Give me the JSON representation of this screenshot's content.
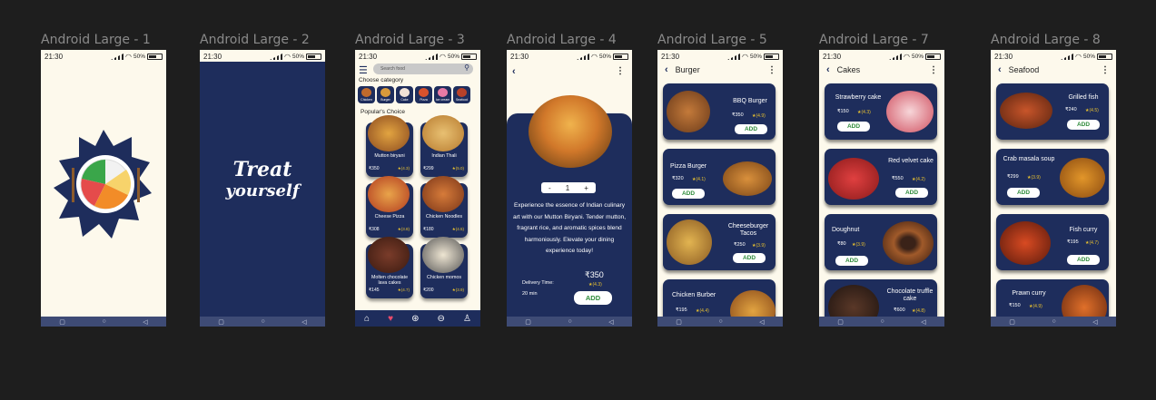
{
  "frames": [
    {
      "label": "Android Large - 1"
    },
    {
      "label": "Android Large - 2"
    },
    {
      "label": "Android Large - 3"
    },
    {
      "label": "Android Large - 4"
    },
    {
      "label": "Android Large - 5"
    },
    {
      "label": "Android Large - 7"
    },
    {
      "label": "Android Large - 8"
    }
  ],
  "status": {
    "time": "21:30",
    "battery": "50%"
  },
  "splash": {
    "logo_text_1": "Treat",
    "logo_text_2": "yourself"
  },
  "home": {
    "search_placeholder": "Search food",
    "choose_category": "Choose category",
    "categories": [
      "Chicken",
      "Burger",
      "Cake",
      "Pizza",
      "Ice cream",
      "Seafood"
    ],
    "popular": "Popular's Choice",
    "items": [
      {
        "name": "Mutton biryani",
        "price": "₹350",
        "rating": "★(4.3)"
      },
      {
        "name": "Indian Thali",
        "price": "₹299",
        "rating": "★(5.0)"
      },
      {
        "name": "Cheese Pizza",
        "price": "₹308",
        "rating": "★(3.8)"
      },
      {
        "name": "Chicken Noodles",
        "price": "₹180",
        "rating": "★(4.5)"
      },
      {
        "name": "Molten chocolate lava cakes",
        "price": "₹145",
        "rating": "★(4.7)"
      },
      {
        "name": "Chicken momos",
        "price": "₹200",
        "rating": "★(3.9)"
      }
    ]
  },
  "detail": {
    "qty_minus": "-",
    "qty": "1",
    "qty_plus": "+",
    "description": "Experience the essence of Indian culinary art with our Mutton Biryani. Tender mutton, fragrant rice, and aromatic spices blend harmoniously. Elevate your dining experience today!",
    "price": "₹350",
    "rating": "★(4.3)",
    "delivery_label": "Delivery Time:",
    "delivery_time": "20 min",
    "add": "ADD"
  },
  "burger": {
    "title": "Burger",
    "items": [
      {
        "name": "BBQ Burger",
        "price": "₹350",
        "rating": "★(4.9)"
      },
      {
        "name": "Pizza Burger",
        "price": "₹320",
        "rating": "★(4.1)"
      },
      {
        "name": "Cheeseburger Tacos",
        "price": "₹250",
        "rating": "★(3.9)"
      },
      {
        "name": "Chicken Burber",
        "price": "₹195",
        "rating": "★(4.4)"
      }
    ]
  },
  "cakes": {
    "title": "Cakes",
    "items": [
      {
        "name": "Strawberry cake",
        "price": "₹150",
        "rating": "★(4.3)"
      },
      {
        "name": "Red velvet cake",
        "price": "₹550",
        "rating": "★(4.2)"
      },
      {
        "name": "Doughnut",
        "price": "₹80",
        "rating": "★(3.9)"
      },
      {
        "name": "Chocolate truffle cake",
        "price": "₹600",
        "rating": "★(4.8)"
      }
    ]
  },
  "seafood": {
    "title": "Seafood",
    "items": [
      {
        "name": "Grilled fish",
        "price": "₹240",
        "rating": "★(4.5)"
      },
      {
        "name": "Crab masala soup",
        "price": "₹299",
        "rating": "★(3.9)"
      },
      {
        "name": "Fish curry",
        "price": "₹195",
        "rating": "★(4.7)"
      },
      {
        "name": "Prawn curry",
        "price": "₹150",
        "rating": "★(4.9)"
      }
    ]
  },
  "add_label": "ADD",
  "colors": {
    "navy": "#1e2d5c",
    "cream": "#fdf9ec",
    "green": "#2e8b3a",
    "star": "#e9c230"
  }
}
